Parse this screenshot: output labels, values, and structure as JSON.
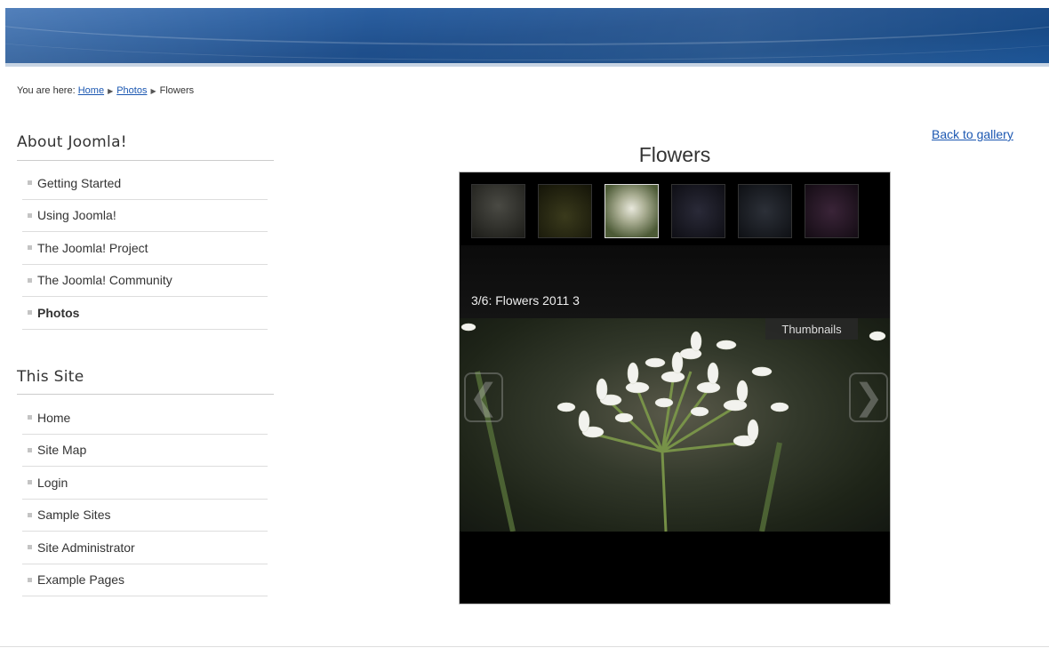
{
  "breadcrumb": {
    "prefix": "You are here:",
    "items": [
      {
        "label": "Home",
        "link": true
      },
      {
        "label": "Photos",
        "link": true
      },
      {
        "label": "Flowers",
        "link": false
      }
    ]
  },
  "about_menu": {
    "title": "About Joomla!",
    "items": [
      {
        "label": "Getting Started"
      },
      {
        "label": "Using Joomla!"
      },
      {
        "label": "The Joomla! Project"
      },
      {
        "label": "The Joomla! Community"
      },
      {
        "label": "Photos",
        "active": true
      }
    ]
  },
  "site_menu": {
    "title": "This Site",
    "items": [
      {
        "label": "Home"
      },
      {
        "label": "Site Map"
      },
      {
        "label": "Login"
      },
      {
        "label": "Sample Sites"
      },
      {
        "label": "Site Administrator"
      },
      {
        "label": "Example Pages"
      }
    ]
  },
  "gallery": {
    "back_label": "Back to gallery",
    "title": "Flowers",
    "caption": "3/6: Flowers 2011 3",
    "thumbnails_label": "Thumbnails",
    "active_index": 2,
    "thumb_count": 6
  },
  "colors": {
    "link": "#1b57b1",
    "banner": "#1f4f8c",
    "viewer_bg": "#000000"
  }
}
